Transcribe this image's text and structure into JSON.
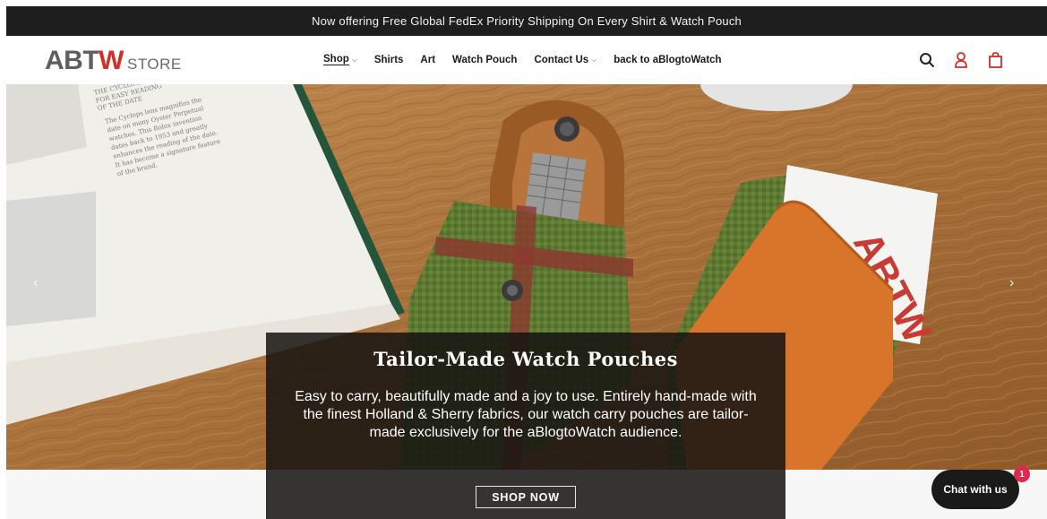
{
  "announcement": "Now offering Free Global FedEx Priority Shipping On Every Shirt & Watch Pouch",
  "logo": {
    "abt": "ABT",
    "w": "W",
    "sub": "STORE"
  },
  "nav": {
    "items": [
      {
        "label": "Shop"
      },
      {
        "label": "Shirts"
      },
      {
        "label": "Art"
      },
      {
        "label": "Watch Pouch"
      },
      {
        "label": "Contact Us"
      },
      {
        "label": "back to aBlogtoWatch"
      }
    ]
  },
  "header_icons": [
    "search-icon",
    "account-icon",
    "cart-icon"
  ],
  "hero": {
    "title": "Tailor-Made Watch Pouches",
    "description": "Easy to carry, beautifully made and a joy to use. Entirely hand-made with the finest Holland & Sherry fabrics, our watch carry pouches are tailor-made exclusively for the aBlogtoWatch audience.",
    "button": "SHOP NOW",
    "book_text": "The Cyclops lens magnifies the date on many Oyster Perpetual watches. This Rolex invention dates back to 1953 and greatly enhances the reading of the date. It has become a signature feature of the brand.",
    "card_text": "ABTW"
  },
  "chat": {
    "label": "Chat with us",
    "badge": "1"
  },
  "colors": {
    "brand_red": "#d42e25",
    "announcement_bg": "#1e1e1e",
    "badge": "#e0284e"
  }
}
